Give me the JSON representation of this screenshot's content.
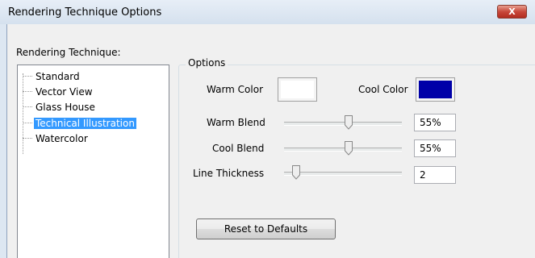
{
  "window": {
    "title": "Rendering Technique Options",
    "close_label": "X"
  },
  "left_panel": {
    "label": "Rendering Technique:",
    "items": [
      {
        "label": "Standard",
        "selected": false
      },
      {
        "label": "Vector View",
        "selected": false
      },
      {
        "label": "Glass House",
        "selected": false
      },
      {
        "label": "Technical Illustration",
        "selected": true
      },
      {
        "label": "Watercolor",
        "selected": false
      }
    ]
  },
  "options": {
    "group_title": "Options",
    "warm_color": {
      "label": "Warm Color",
      "color": "#ffffff"
    },
    "cool_color": {
      "label": "Cool Color",
      "color": "#0000a8"
    },
    "warm_blend": {
      "label": "Warm Blend",
      "value": "55%",
      "fraction": 0.55
    },
    "cool_blend": {
      "label": "Cool Blend",
      "value": "55%",
      "fraction": 0.55
    },
    "line_thickness": {
      "label": "Line Thickness",
      "value": "2",
      "fraction": 0.1
    },
    "reset_label": "Reset to Defaults"
  },
  "colors": {
    "selection": "#3399ff",
    "title_bg": "#dde7f2",
    "close": "#c8473a"
  }
}
